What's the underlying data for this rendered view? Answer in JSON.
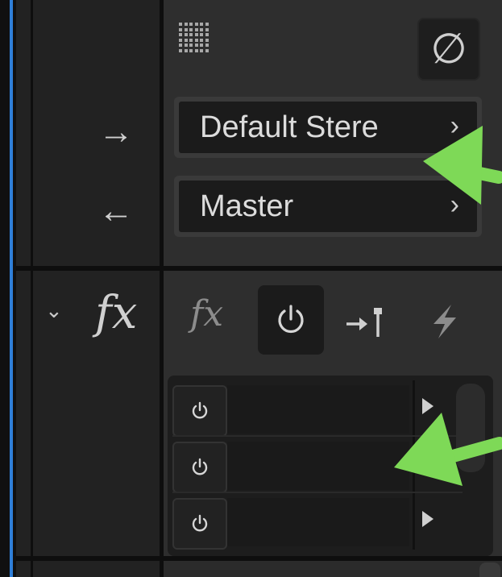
{
  "routing": {
    "output_label": "Default Stere",
    "input_label": "Master",
    "chevron": "›"
  },
  "icons": {
    "null": "∅",
    "fx": "fx",
    "arrow_right": "→",
    "arrow_left": "←",
    "chevron_down": "⌄"
  },
  "effects_rack": {
    "slots": [
      {
        "enabled": true
      },
      {
        "enabled": true
      },
      {
        "enabled": true
      }
    ]
  },
  "colors": {
    "accent_blue": "#2f7fd8",
    "annotation_green": "#7ed957",
    "panel": "#2e2e2e",
    "field": "#1b1b1b"
  }
}
